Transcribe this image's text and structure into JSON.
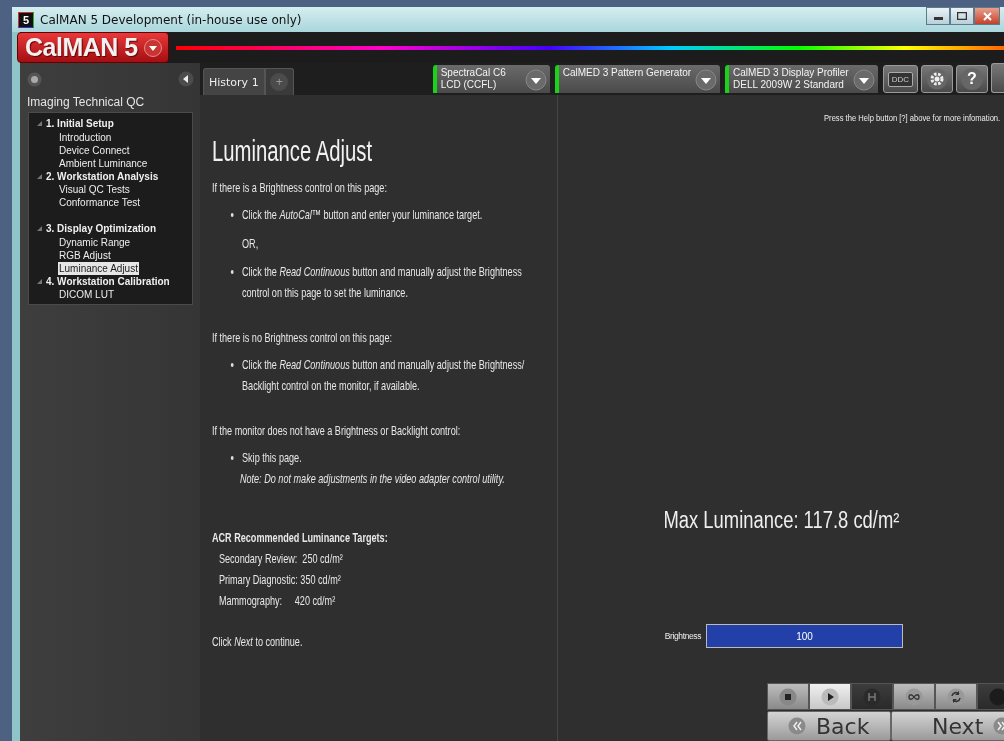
{
  "window": {
    "icon_text": "5",
    "title": "CalMAN 5 Development (in-house use only)"
  },
  "logo": {
    "text": "CalMAN 5"
  },
  "sidebar": {
    "title": "Imaging Technical QC",
    "tree": [
      {
        "label": "1. Initial Setup",
        "expanded": true,
        "children": [
          {
            "label": "Introduction",
            "selected": false
          },
          {
            "label": "Device Connect",
            "selected": false
          },
          {
            "label": "Ambient Luminance",
            "selected": false
          }
        ]
      },
      {
        "label": "2. Workstation Analysis",
        "expanded": true,
        "children": [
          {
            "label": "Visual QC Tests",
            "selected": false
          },
          {
            "label": "Conformance Test",
            "selected": false
          }
        ]
      },
      {
        "label": "3. Display Optimization",
        "expanded": true,
        "children": [
          {
            "label": "Dynamic Range",
            "selected": false
          },
          {
            "label": "RGB Adjust",
            "selected": false
          },
          {
            "label": "Luminance Adjust",
            "selected": true
          }
        ]
      },
      {
        "label": "4. Workstation Calibration",
        "expanded": true,
        "children": [
          {
            "label": "DICOM LUT",
            "selected": false
          }
        ]
      }
    ]
  },
  "tabs": [
    {
      "label": "History 1",
      "selected": true
    }
  ],
  "add_tab": {
    "label": "+"
  },
  "devices": [
    {
      "lines": [
        "SpectraCal C6",
        "LCD (CCFL)"
      ],
      "connected": true
    },
    {
      "lines": [
        "CalMED 3 Pattern Generator"
      ],
      "connected": true
    },
    {
      "lines": [
        "CalMED 3 Display Profiler",
        "DELL 2009W 2 Standard"
      ],
      "connected": true
    }
  ],
  "tools": [
    {
      "kind": "ddc",
      "label": "DDC"
    },
    {
      "kind": "settings"
    },
    {
      "kind": "help",
      "label": "?"
    },
    {
      "kind": "partial"
    }
  ],
  "help_note": "Press the Help button [?] above for more infomation.",
  "page": {
    "title": "Luminance Adjust",
    "blocks": [
      {
        "kind": "para",
        "text": "If there is a Brightness control on this page:"
      },
      {
        "kind": "bullet",
        "text": "Click the *AutoCal™* button and enter your luminance target."
      },
      {
        "kind": "or",
        "text": "OR,"
      },
      {
        "kind": "bullet",
        "text": "Click the *Read Continuous* button and manually adjust the Brightness control on this page to set the luminance."
      },
      {
        "kind": "para",
        "text": "If there is no Brightness control on this page:"
      },
      {
        "kind": "bullet",
        "text": "Click the *Read Continuous* button and manually adjust the Brightness/ Backlight control on the monitor, if available."
      },
      {
        "kind": "para",
        "text": "If the monitor does not have a Brightness or Backlight control:"
      },
      {
        "kind": "bullet",
        "text": "Skip this page."
      },
      {
        "kind": "note",
        "text": "Note: Do not make adjustments in the video adapter control utility."
      },
      {
        "kind": "heading",
        "text": "ACR Recommended Luminance Targets:"
      },
      {
        "kind": "target",
        "text": "Secondary Review:  250 cd/m²"
      },
      {
        "kind": "target",
        "text": "Primary Diagnostic: 350 cd/m²"
      },
      {
        "kind": "target",
        "text": "Mammography:     420 cd/m²"
      },
      {
        "kind": "closing",
        "text": "Click *Next* to continue."
      }
    ]
  },
  "reading": {
    "text": "Max Luminance: 117.8 cd/m²"
  },
  "brightness": {
    "label": "Brightness",
    "value": "100",
    "level": 1
  },
  "transport": [
    {
      "kind": "stop",
      "selected": false,
      "disabled": false
    },
    {
      "kind": "play",
      "selected": true,
      "disabled": false
    },
    {
      "kind": "hold",
      "selected": false,
      "disabled": true
    },
    {
      "kind": "loop",
      "selected": false,
      "disabled": false
    },
    {
      "kind": "refresh",
      "selected": false,
      "disabled": false
    },
    {
      "kind": "record",
      "selected": false,
      "disabled": true
    }
  ],
  "nav": [
    {
      "kind": "back",
      "label": "Back"
    },
    {
      "kind": "next",
      "label": "Next"
    }
  ]
}
